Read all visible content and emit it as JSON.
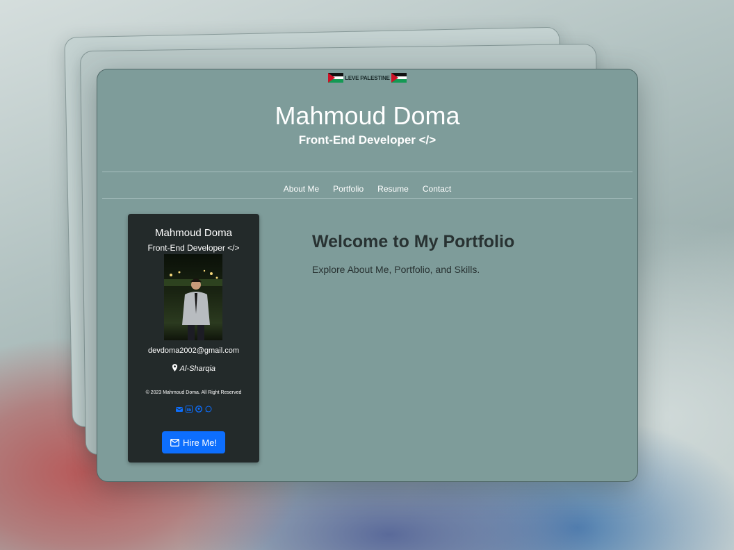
{
  "banner": {
    "text": "LEVE PALESTINE"
  },
  "header": {
    "title": "Mahmoud Doma",
    "subtitle": "Front-End Developer </>"
  },
  "nav": {
    "items": [
      "About Me",
      "Portfolio",
      "Resume",
      "Contact"
    ]
  },
  "profile": {
    "name": "Mahmoud Doma",
    "role": "Front-End Developer </>",
    "email": "devdoma2002@gmail.com",
    "location": "Al-Sharqia",
    "copyright": "© 2023 Mahmoud Doma. All Right Reserved",
    "socials": [
      "envelope-icon",
      "linkedin-icon",
      "github-icon",
      "whatsapp-icon"
    ],
    "hire_label": "Hire Me!"
  },
  "main": {
    "heading": "Welcome to My Portfolio",
    "intro": "Explore About Me, Portfolio, and Skills."
  },
  "colors": {
    "accent": "#0d6efd",
    "card_bg": "#232a2a",
    "window_bg": "#7e9c9a"
  }
}
